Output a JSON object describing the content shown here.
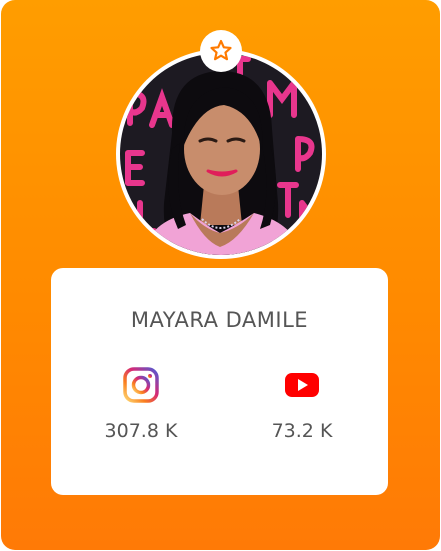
{
  "profile": {
    "name": "MAYARA DAMILE"
  },
  "stats": [
    {
      "platform": "instagram",
      "icon": "instagram-icon",
      "count": "307.8 K"
    },
    {
      "platform": "youtube",
      "icon": "youtube-icon",
      "count": "73.2 K"
    }
  ],
  "badge": {
    "icon": "star-icon"
  },
  "colors": {
    "card_gradient_top": "#ff9d00",
    "card_gradient_bottom": "#ff7a06",
    "star_accent": "#ff7a00",
    "youtube_red": "#ff0000",
    "text_gray": "#555555"
  }
}
